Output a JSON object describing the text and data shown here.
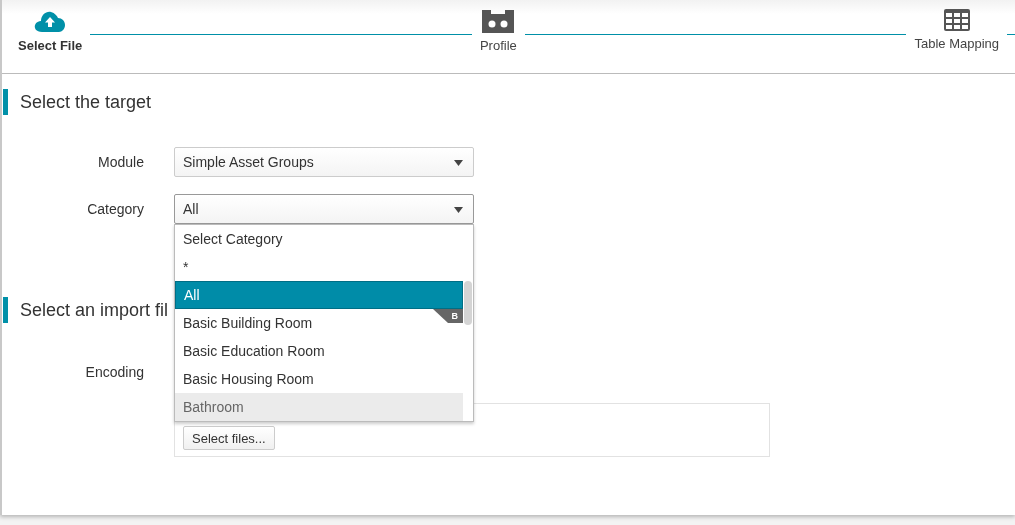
{
  "steps": [
    {
      "label": "Select File",
      "active": true
    },
    {
      "label": "Profile",
      "active": false
    },
    {
      "label": "Table Mapping",
      "active": false
    }
  ],
  "target": {
    "heading": "Select the target",
    "module": {
      "label": "Module",
      "value": "Simple Asset Groups"
    },
    "category": {
      "label": "Category",
      "value": "All",
      "expanded": true,
      "options": [
        {
          "label": "Select Category",
          "selected": false,
          "hovered": false
        },
        {
          "label": "*",
          "selected": false,
          "hovered": false
        },
        {
          "label": "All",
          "selected": true,
          "hovered": false
        },
        {
          "label": "Basic Building Room",
          "selected": false,
          "hovered": false,
          "badge": "B"
        },
        {
          "label": "Basic Education Room",
          "selected": false,
          "hovered": false
        },
        {
          "label": "Basic Housing Room",
          "selected": false,
          "hovered": false
        },
        {
          "label": "Bathroom",
          "selected": false,
          "hovered": true
        }
      ]
    }
  },
  "import": {
    "heading": "Select an import fil",
    "encoding": {
      "label": "Encoding"
    },
    "upload": {
      "button": "Select files..."
    }
  }
}
